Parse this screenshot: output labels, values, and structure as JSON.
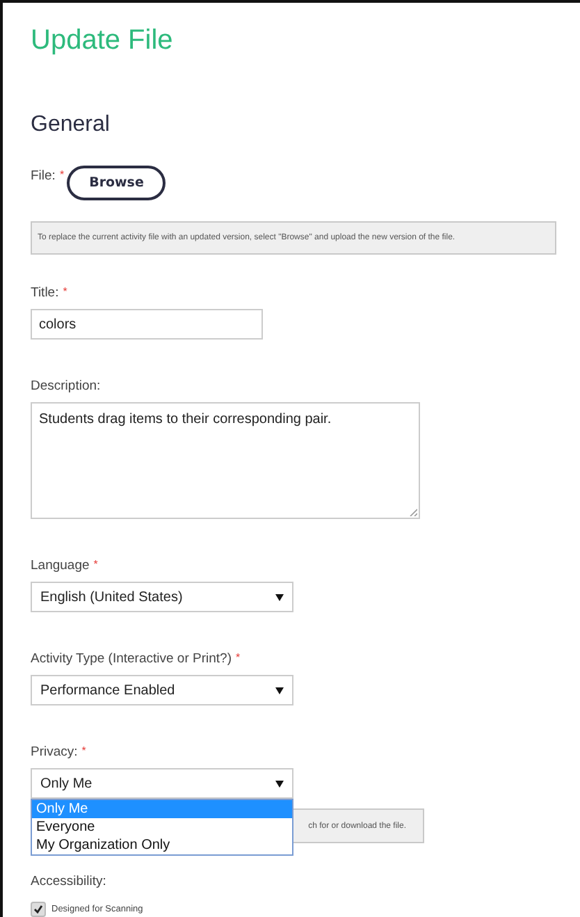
{
  "page": {
    "title": "Update File",
    "section": "General"
  },
  "file": {
    "label": "File:",
    "required_mark": "*",
    "button": "Browse",
    "note": "To replace the current activity file with an updated version, select \"Browse\" and upload the new version of the file."
  },
  "title_field": {
    "label": "Title:",
    "required_mark": "*",
    "value": "colors"
  },
  "description": {
    "label": "Description:",
    "value": "Students drag items to their corresponding pair."
  },
  "language": {
    "label": "Language",
    "required_mark": "*",
    "value": "English (United States)"
  },
  "activity_type": {
    "label": "Activity Type (Interactive or Print?)",
    "required_mark": "*",
    "value": "Performance Enabled"
  },
  "privacy": {
    "label": "Privacy:",
    "required_mark": "*",
    "value": "Only Me",
    "expanded": true,
    "options": [
      {
        "label": "Only Me",
        "selected": true
      },
      {
        "label": "Everyone",
        "selected": false
      },
      {
        "label": "My Organization Only",
        "selected": false
      }
    ],
    "note": "ch for or download the file."
  },
  "accessibility": {
    "label": "Accessibility:",
    "options": [
      {
        "label": "Designed for Scanning",
        "checked": true
      }
    ]
  }
}
